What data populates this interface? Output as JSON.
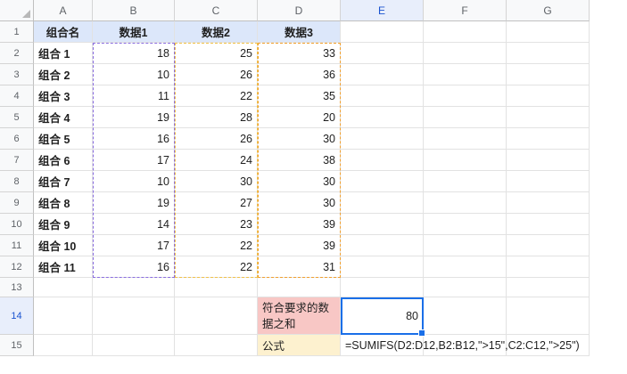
{
  "columns": [
    "A",
    "B",
    "C",
    "D",
    "E",
    "F",
    "G"
  ],
  "selected_column": "E",
  "rows": [
    "1",
    "2",
    "3",
    "4",
    "5",
    "6",
    "7",
    "8",
    "9",
    "10",
    "11",
    "12",
    "13",
    "14",
    "15"
  ],
  "selected_row": "14",
  "headers": {
    "a1": "组合名",
    "b1": "数据1",
    "c1": "数据2",
    "d1": "数据3"
  },
  "table": [
    {
      "name": "组合 1",
      "d1": "18",
      "d2": "25",
      "d3": "33"
    },
    {
      "name": "组合 2",
      "d1": "10",
      "d2": "26",
      "d3": "36"
    },
    {
      "name": "组合 3",
      "d1": "11",
      "d2": "22",
      "d3": "35"
    },
    {
      "name": "组合 4",
      "d1": "19",
      "d2": "28",
      "d3": "20"
    },
    {
      "name": "组合 5",
      "d1": "16",
      "d2": "26",
      "d3": "30"
    },
    {
      "name": "组合 6",
      "d1": "17",
      "d2": "24",
      "d3": "38"
    },
    {
      "name": "组合 7",
      "d1": "10",
      "d2": "30",
      "d3": "30"
    },
    {
      "name": "组合 8",
      "d1": "19",
      "d2": "27",
      "d3": "30"
    },
    {
      "name": "组合 9",
      "d1": "14",
      "d2": "23",
      "d3": "39"
    },
    {
      "name": "组合 10",
      "d1": "17",
      "d2": "22",
      "d3": "39"
    },
    {
      "name": "组合 11",
      "d1": "16",
      "d2": "22",
      "d3": "31"
    }
  ],
  "result": {
    "label": "符合要求的数据之和",
    "value": "80"
  },
  "formula": {
    "label": "公式",
    "text": "=SUMIFS(D2:D12,B2:B12,\">15\",C2:C12,\">25\")"
  },
  "colors": {
    "header_fill": "#dce7fa",
    "result_label_fill": "#f8c7c5",
    "formula_label_fill": "#fdf1cf",
    "selection": "#1a6fe8",
    "range_b": "#8a6de0",
    "range_c": "#f0c24a",
    "range_d": "#f0a030"
  }
}
